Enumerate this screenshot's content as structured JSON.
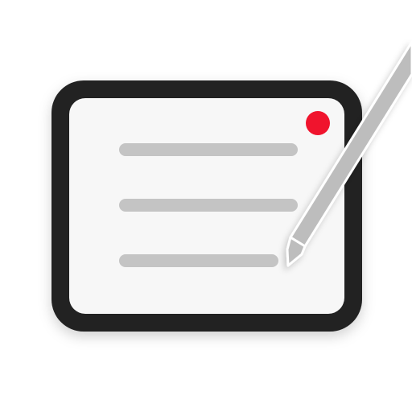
{
  "app_icon": {
    "name": "notes-tablet-icon",
    "colors": {
      "background": "#ffffff",
      "frame": "#222222",
      "screen": "#f7f7f7",
      "lines": "#c4c4c4",
      "record_dot": "#f0142d",
      "pencil": "#bdbdbd"
    },
    "elements": [
      "tablet-frame",
      "tablet-screen",
      "text-line",
      "text-line",
      "text-line",
      "record-dot",
      "pencil-icon"
    ]
  }
}
